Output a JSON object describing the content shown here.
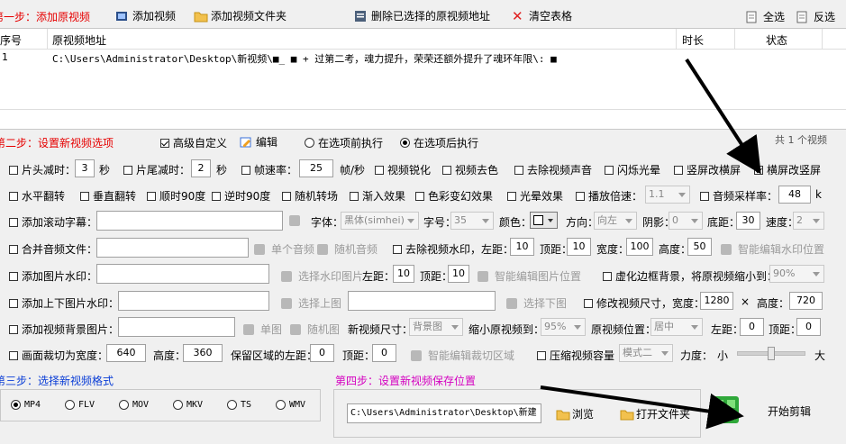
{
  "toolbar": {
    "step1": "第一步：添加原视频",
    "add_video": "添加视频",
    "add_folder": "添加视频文件夹",
    "delete_selected": "删除已选择的原视频地址",
    "clear_table": "清空表格",
    "select_all": "全选",
    "invert": "反选"
  },
  "table": {
    "headers": {
      "index": "序号",
      "path": "原视频地址",
      "duration": "时长",
      "status": "状态"
    },
    "rows": [
      {
        "index": "1",
        "path": "C:\\Users\\Administrator\\Desktop\\新视频\\■_ ■  +   过第二考，魂力提升，荣荣还额外提升了魂环年限\\: ■",
        "duration": "",
        "status": ""
      }
    ],
    "count": "共 1 个视频"
  },
  "step2": {
    "title": "第二步：设置新视频选项",
    "advanced": "高级自定义",
    "edit": "编辑",
    "before": "在选项前执行",
    "after": "在选项后执行"
  },
  "opts": {
    "head_cut": "片头减时：",
    "head_val": "3",
    "sec1": "秒",
    "tail_cut": "片尾减时：",
    "tail_val": "2",
    "sec2": "秒",
    "fps": "帧速率：",
    "fps_val": "25",
    "fps_unit": "帧/秒",
    "sharpen": "视频锐化",
    "decolor": "视频去色",
    "mute": "去除视频声音",
    "flash": "闪烁光晕",
    "v2h": "竖屏改横屏",
    "h2v": "横屏改竖屏",
    "hflip": "水平翻转",
    "vflip": "垂直翻转",
    "cw90": "顺时90度",
    "ccw90": "逆时90度",
    "random_trans": "随机转场",
    "fade_in": "渐入效果",
    "color_shift": "色彩变幻效果",
    "halo": "光晕效果",
    "speed": "播放倍速：",
    "speed_val": "1.1",
    "sample_rate": "音频采样率：",
    "sample_val": "48",
    "sample_unit": "k",
    "scroll_sub": "添加滚动字幕：",
    "font_lbl": "字体：",
    "font_val": "黑体(simhei)",
    "size_lbl": "字号：",
    "size_val": "35",
    "color_lbl": "颜色：",
    "dir_lbl": "方向：",
    "dir_val": "向左",
    "shadow_lbl": "阴影：",
    "shadow_val": "0",
    "bottom_lbl": "底距：",
    "bottom_val": "30",
    "spd_lbl": "速度：",
    "spd_val": "2",
    "merge_audio": "合并音频文件：",
    "single_audio": "单个音频",
    "rand_audio": "随机音频",
    "rm_watermark": "去除视频水印，左距：",
    "wm_left": "10",
    "top_lbl1": "顶距：",
    "wm_top": "10",
    "width_lbl1": "宽度：",
    "wm_w": "100",
    "height_lbl1": "高度：",
    "wm_h": "50",
    "smart_wm": "智能编辑水印位置",
    "img_wm": "添加图片水印：",
    "pick_wm": "选择水印图片",
    "left_lbl2": "左距：",
    "iw_left": "10",
    "top_lbl2": "顶距：",
    "iw_top": "10",
    "smart_img": "智能编辑图片位置",
    "blur_bg": "虚化边框背景，将原视频缩小到：",
    "blur_val": "90%",
    "tb_wm": "添加上下图片水印：",
    "pick_top": "选择上图",
    "pick_bottom": "选择下图",
    "resize": "修改视频尺寸，宽度：",
    "rs_w": "1280",
    "times": "×",
    "height_lbl2": "高度：",
    "rs_h": "720",
    "bg_img": "添加视频背景图片：",
    "single_img": "单图",
    "rand_img": "随机图",
    "new_size": "新视频尺寸：",
    "new_size_val": "背景图",
    "shrink": "缩小原视频到：",
    "shrink_val": "95%",
    "pos_lbl": "原视频位置：",
    "pos_val": "居中",
    "left_lbl3": "左距：",
    "bg_left": "0",
    "top_lbl3": "顶距：",
    "bg_top": "0",
    "crop": "画面裁切为宽度：",
    "crop_w": "640",
    "height_lbl3": "高度：",
    "crop_h": "360",
    "keep_left": "保留区域的左距：",
    "keep_left_val": "0",
    "top_lbl4": "顶距：",
    "keep_top_val": "0",
    "smart_crop": "智能编辑裁切区域",
    "compress": "压缩视频容量",
    "mode_val": "模式二",
    "strength": "力度：",
    "small": "小",
    "large": "大"
  },
  "step3": {
    "title": "第三步：选择新视频格式",
    "formats": [
      "MP4",
      "FLV",
      "MOV",
      "MKV",
      "TS",
      "WMV"
    ]
  },
  "step4": {
    "title": "第四步：设置新视频保存位置",
    "path": "C:\\Users\\Administrator\\Desktop\\新建文件",
    "browse": "浏览",
    "open_folder": "打开文件夹",
    "start": "开始剪辑"
  }
}
